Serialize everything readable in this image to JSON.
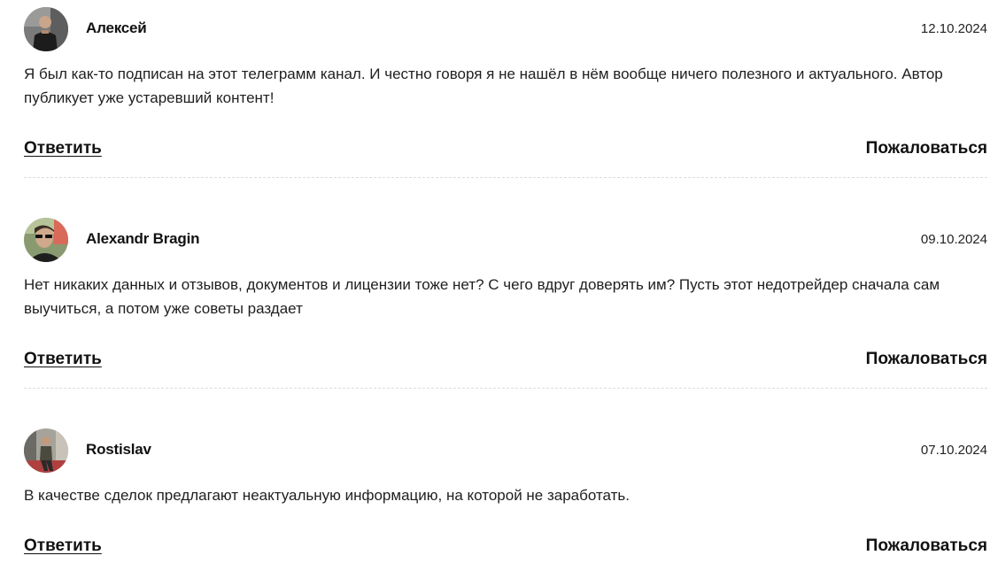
{
  "comments": [
    {
      "author": "Алексей",
      "date": "12.10.2024",
      "text": "Я был как-то подписан на этот телеграмм канал. И честно говоря я не нашёл в нём вообще ничего полезного и актуального. Автор публикует уже устаревший контент!",
      "reply_label": "Ответить",
      "report_label": "Пожаловаться"
    },
    {
      "author": "Alexandr Bragin",
      "date": "09.10.2024",
      "text": "Нет никаких данных и отзывов, документов и лицензии тоже нет? С чего вдруг доверять им? Пусть этот недотрейдер сначала сам выучиться, а потом уже советы раздает",
      "reply_label": "Ответить",
      "report_label": "Пожаловаться"
    },
    {
      "author": "Rostislav",
      "date": "07.10.2024",
      "text": "В качестве сделок предлагают неактуальную информацию, на которой не заработать.",
      "reply_label": "Ответить",
      "report_label": "Пожаловаться"
    }
  ],
  "colors": {
    "text": "#1a1a1a",
    "divider": "#dcdcdc",
    "background": "#ffffff"
  }
}
